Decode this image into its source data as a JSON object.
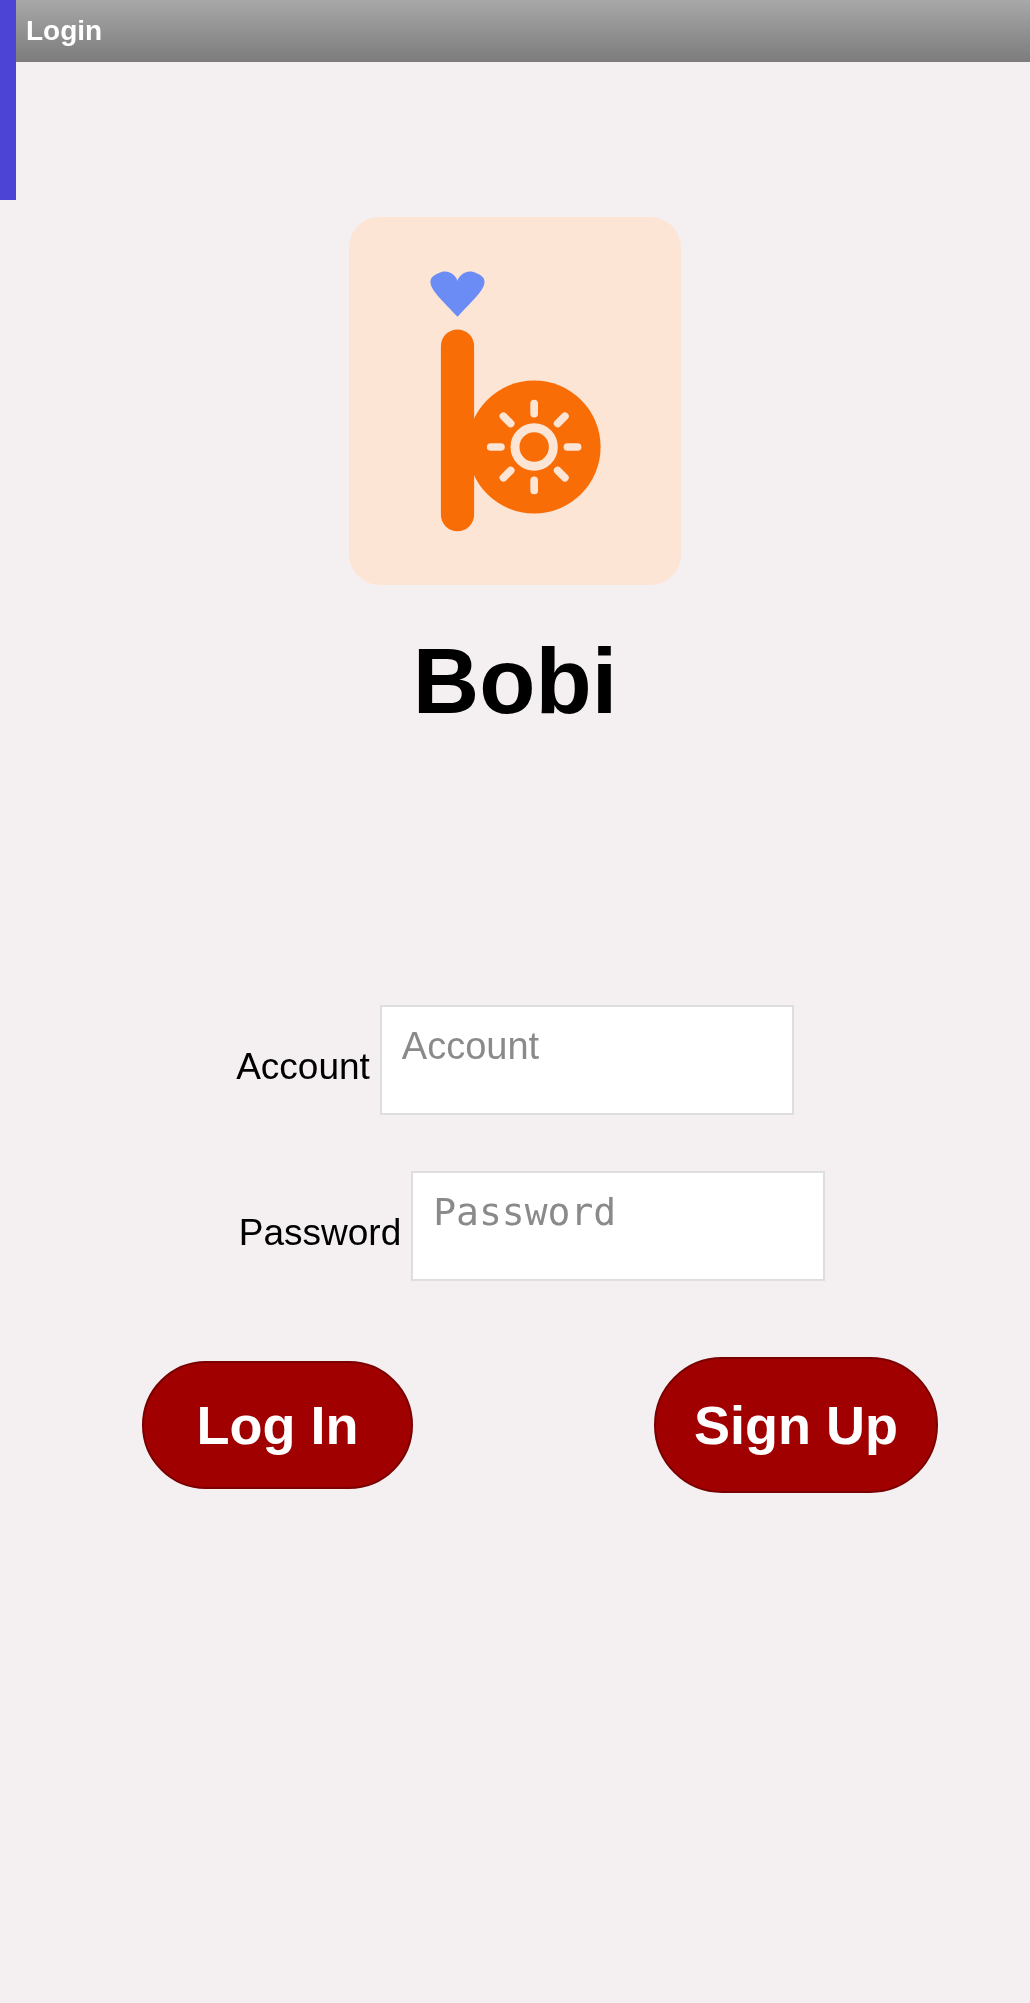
{
  "window": {
    "title": "Login"
  },
  "app": {
    "name": "Bobi"
  },
  "form": {
    "fields": [
      {
        "label": "Account",
        "placeholder": "Account",
        "kind": "text"
      },
      {
        "label": "Password",
        "placeholder": "Password",
        "kind": "password"
      }
    ]
  },
  "buttons": [
    "Log In",
    "Sign Up"
  ]
}
